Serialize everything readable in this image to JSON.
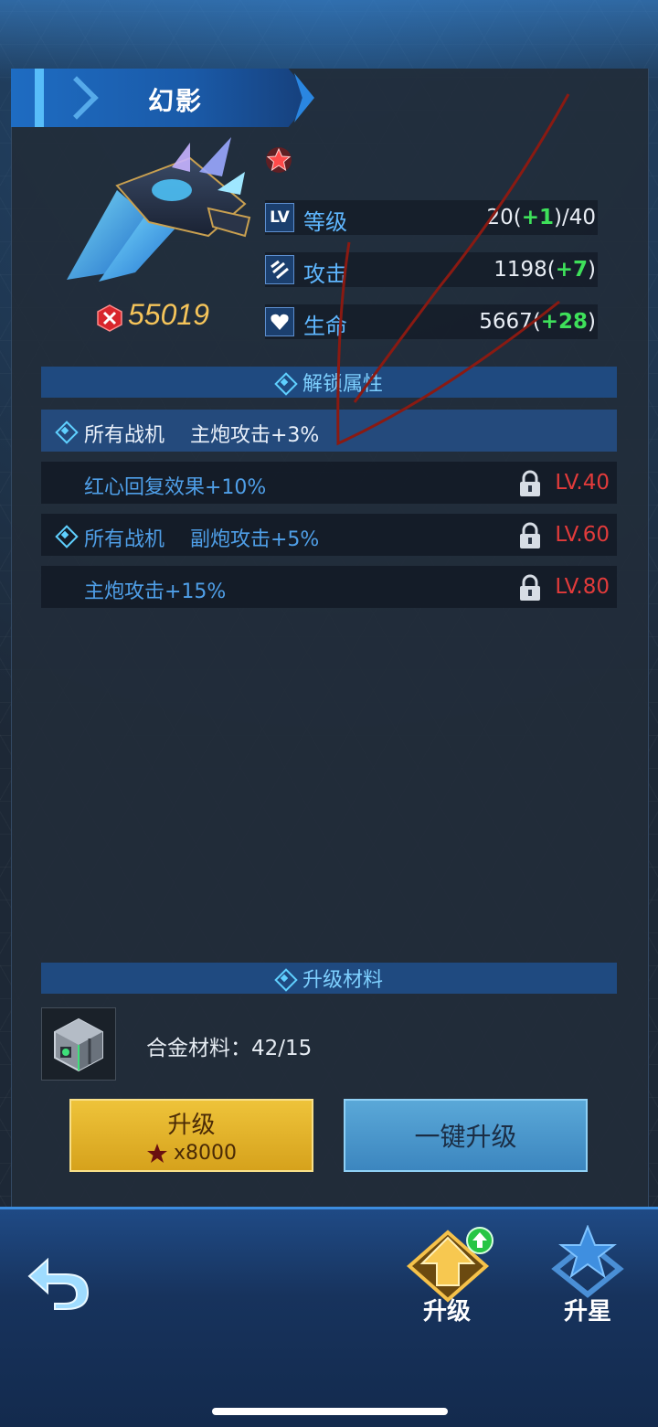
{
  "title": "幻影",
  "power": "55019",
  "stats": [
    {
      "icon": "LV",
      "label": "等级",
      "base": "20(",
      "plus": "+1",
      "tail": ")/40"
    },
    {
      "icon": "attack-icon",
      "label": "攻击",
      "base": "1198(",
      "plus": "+7",
      "tail": ")"
    },
    {
      "icon": "heart-shield-icon",
      "label": "生命",
      "base": "5667(",
      "plus": "+28",
      "tail": ")"
    }
  ],
  "unlock_section": {
    "title": "解锁属性"
  },
  "attributes": [
    {
      "text": "所有战机    主炮攻击+3%",
      "lv": ""
    },
    {
      "text": "红心回复效果+10%",
      "lv": "LV.40"
    },
    {
      "text": "所有战机    副炮攻击+5%",
      "lv": "LV.60"
    },
    {
      "text": "主炮攻击+15%",
      "lv": "LV.80"
    }
  ],
  "material_section": {
    "title": "升级材料"
  },
  "material": {
    "text": "合金材料：42/15",
    "icon": "alloy-cube-icon"
  },
  "buttons": {
    "upgrade_label": "升级",
    "upgrade_cost": "x8000",
    "auto_upgrade_label": "一键升级"
  },
  "nav": {
    "upgrade_label": "升级",
    "star_label": "升星"
  },
  "colors": {
    "accent_blue": "#5fb7ff",
    "gold": "#f5c45a",
    "positive_green": "#3ee05a",
    "locked_red": "#e23b3b"
  }
}
